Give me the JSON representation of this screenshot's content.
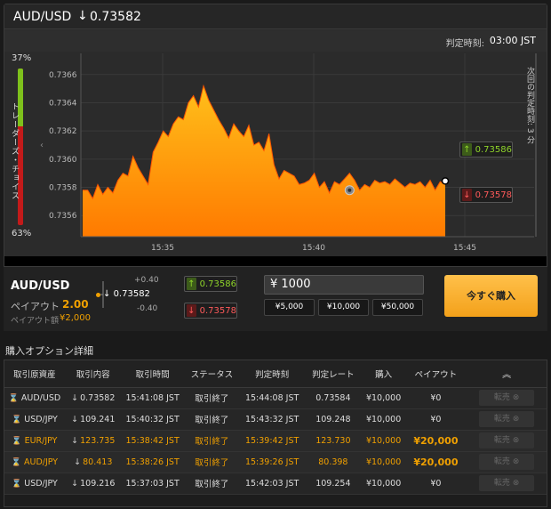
{
  "header": {
    "pair": "AUD/USD",
    "arrow": "↓",
    "rate": "0.73582"
  },
  "deadline": {
    "label": "判定時刻:",
    "time": "03:00 JST"
  },
  "ratio": {
    "high_pct": "37%",
    "low_pct": "63%",
    "high_fraction": 0.37,
    "label": "トレーダーズ・チョイス"
  },
  "next_deadline_label": "次回の判定時刻: 3 分",
  "chart_data": {
    "type": "area",
    "x_ticks": [
      "15:35",
      "15:40",
      "15:45"
    ],
    "y_ticks": [
      "0.7366",
      "0.7364",
      "0.7362",
      "0.7360",
      "0.7358",
      "0.7356"
    ],
    "ylim": [
      0.73545,
      0.73675
    ],
    "x": [
      0,
      2,
      4,
      6,
      8,
      10,
      12,
      14,
      16,
      18,
      20,
      22,
      24,
      26,
      28,
      30,
      32,
      34,
      36,
      38,
      40,
      42,
      44,
      46,
      48,
      50,
      52,
      54,
      56,
      58,
      60,
      62,
      64,
      66,
      68,
      70,
      72,
      74,
      76,
      78,
      80,
      82,
      84,
      86,
      88,
      90,
      92,
      94,
      96,
      98,
      100,
      102,
      104,
      106,
      108,
      110,
      112,
      114,
      116,
      118,
      120,
      122,
      124,
      126,
      128,
      130,
      132,
      134,
      136,
      138,
      140,
      142,
      144
    ],
    "values": [
      0.73578,
      0.73578,
      0.73572,
      0.73582,
      0.73575,
      0.7358,
      0.73576,
      0.73585,
      0.7359,
      0.73588,
      0.73602,
      0.73594,
      0.73588,
      0.73582,
      0.73605,
      0.73612,
      0.7362,
      0.73616,
      0.73625,
      0.7363,
      0.73628,
      0.7364,
      0.73645,
      0.73637,
      0.73652,
      0.73642,
      0.73635,
      0.73628,
      0.73622,
      0.73615,
      0.73625,
      0.7362,
      0.73616,
      0.73624,
      0.7361,
      0.73612,
      0.73606,
      0.73618,
      0.73596,
      0.73586,
      0.73592,
      0.7359,
      0.73588,
      0.73582,
      0.73583,
      0.73585,
      0.7359,
      0.7358,
      0.73584,
      0.73576,
      0.73584,
      0.73582,
      0.73586,
      0.7359,
      0.73585,
      0.73578,
      0.73582,
      0.7358,
      0.73585,
      0.73583,
      0.73584,
      0.73582,
      0.73586,
      0.73583,
      0.7358,
      0.73583,
      0.73582,
      0.73584,
      0.7358,
      0.73585,
      0.73578,
      0.73584,
      0.73582
    ],
    "high_price": "0.73586",
    "low_price": "0.73578",
    "colors": {
      "fill_top": "#ffbf1a",
      "fill_bottom": "#ff7a00",
      "stroke": "#ff5500"
    }
  },
  "control": {
    "pair": "AUD/USD",
    "payout_label": "ペイアウト",
    "payout_value": "2.00",
    "payout_amount_label": "ペイアウト額",
    "payout_amount": "¥2,000",
    "strike_up": "+0.40",
    "strike_rate": "0.73582",
    "strike_down": "-0.40",
    "high_price": "0.73586",
    "low_price": "0.73578",
    "amount": "¥ 1000",
    "quick": [
      "¥5,000",
      "¥10,000",
      "¥50,000"
    ],
    "buy_label": "今すぐ購入"
  },
  "details": {
    "title": "購入オプション詳細",
    "headers": [
      "取引原資産",
      "取引内容",
      "取引時間",
      "ステータス",
      "判定時刻",
      "判定レート",
      "購入",
      "ペイアウト"
    ],
    "resale_label": "転売",
    "rows": [
      {
        "asset": "AUD/USD",
        "content": "0.73582",
        "time": "15:41:08 JST",
        "status": "取引終了",
        "judge": "15:44:08 JST",
        "rate": "0.73584",
        "buy": "¥10,000",
        "payout": "¥0",
        "hl": false
      },
      {
        "asset": "USD/JPY",
        "content": "109.241",
        "time": "15:40:32 JST",
        "status": "取引終了",
        "judge": "15:43:32 JST",
        "rate": "109.248",
        "buy": "¥10,000",
        "payout": "¥0",
        "hl": false
      },
      {
        "asset": "EUR/JPY",
        "content": "123.735",
        "time": "15:38:42 JST",
        "status": "取引終了",
        "judge": "15:39:42 JST",
        "rate": "123.730",
        "buy": "¥10,000",
        "payout": "¥20,000",
        "hl": true
      },
      {
        "asset": "AUD/JPY",
        "content": "80.413",
        "time": "15:38:26 JST",
        "status": "取引終了",
        "judge": "15:39:26 JST",
        "rate": "80.398",
        "buy": "¥10,000",
        "payout": "¥20,000",
        "hl": true
      },
      {
        "asset": "USD/JPY",
        "content": "109.216",
        "time": "15:37:03 JST",
        "status": "取引終了",
        "judge": "15:42:03 JST",
        "rate": "109.254",
        "buy": "¥10,000",
        "payout": "¥0",
        "hl": false
      }
    ]
  }
}
